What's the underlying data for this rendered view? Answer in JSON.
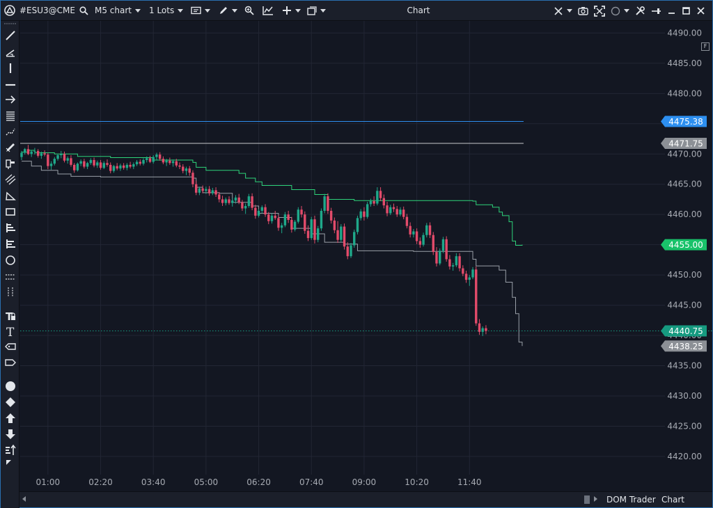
{
  "toolbar": {
    "symbol": "#ESU3@CME",
    "timeframe": "M5 chart",
    "lots": "1 Lots",
    "window_title": "Chart"
  },
  "bottom": {
    "tab_dom": "DOM Trader",
    "tab_chart": "Chart Trader"
  },
  "f_label": "F",
  "colors": {
    "background": "#131722",
    "grid": "#222634",
    "bull": "#1fa88a",
    "bear": "#e24b6a",
    "trail_green": "#2ed47a",
    "trail_gray": "#9aa0a8",
    "blue_line": "#2d8ff0"
  },
  "chart_data": {
    "type": "candlestick",
    "y_range": [
      4417,
      4492
    ],
    "y_ticks": [
      "4490.00",
      "4485.00",
      "4480.00",
      "4475.00",
      "4470.00",
      "4465.00",
      "4460.00",
      "4455.00",
      "4450.00",
      "4445.00",
      "4440.00",
      "4435.00",
      "4430.00",
      "4425.00",
      "4420.00"
    ],
    "x_ticks": [
      "01:00",
      "02:20",
      "03:40",
      "05:00",
      "06:20",
      "07:40",
      "09:00",
      "10:20",
      "11:40"
    ],
    "x_tick_bar_index": [
      8,
      24,
      40,
      56,
      72,
      88,
      104,
      120,
      136
    ],
    "bar_count": 150,
    "horizontal_lines": [
      {
        "price": 4475.38,
        "label": "4475.38",
        "color": "#2d8ff0",
        "label_bg": "#2d8ff0"
      },
      {
        "price": 4471.75,
        "label": "4471.75",
        "color": "#c7c9cc",
        "label_bg": "#8c9096"
      }
    ],
    "price_labels": [
      {
        "price": 4455.0,
        "label": "4455.00",
        "bg": "#19c26a"
      },
      {
        "price": 4440.75,
        "label": "4440.75",
        "bg": "#169a80"
      },
      {
        "price": 4438.25,
        "label": "4438.25",
        "bg": "#8c9096"
      }
    ],
    "last_price": 4440.75,
    "trail_upper": [
      [
        0,
        4470.3
      ],
      [
        2,
        4470.6
      ],
      [
        4,
        4470.2
      ],
      [
        10,
        4470.0
      ],
      [
        17,
        4469.6
      ],
      [
        27,
        4469.4
      ],
      [
        40,
        4469.0
      ],
      [
        52,
        4468.6
      ],
      [
        53,
        4467.8
      ],
      [
        56,
        4467.3
      ],
      [
        66,
        4466.8
      ],
      [
        68,
        4466.0
      ],
      [
        71,
        4465.4
      ],
      [
        73,
        4464.8
      ],
      [
        82,
        4464.1
      ],
      [
        89,
        4463.3
      ],
      [
        93,
        4462.5
      ],
      [
        101,
        4462.3
      ],
      [
        137,
        4462.2
      ],
      [
        138,
        4461.6
      ],
      [
        143,
        4461.2
      ],
      [
        145,
        4460.4
      ],
      [
        146,
        4459.8
      ],
      [
        148,
        4458.8
      ],
      [
        149,
        4455.6
      ],
      [
        150,
        4454.9
      ],
      [
        152,
        4455.0
      ]
    ],
    "trail_lower": [
      [
        0,
        4468.8
      ],
      [
        3,
        4468.0
      ],
      [
        6,
        4467.3
      ],
      [
        11,
        4466.7
      ],
      [
        15,
        4466.3
      ],
      [
        24,
        4466.2
      ],
      [
        52,
        4466.0
      ],
      [
        53,
        4464.5
      ],
      [
        55,
        4463.6
      ],
      [
        60,
        4463.5
      ],
      [
        64,
        4462.0
      ],
      [
        70,
        4461.4
      ],
      [
        72,
        4460.2
      ],
      [
        78,
        4459.5
      ],
      [
        82,
        4457.7
      ],
      [
        88,
        4456.8
      ],
      [
        92,
        4455.4
      ],
      [
        98,
        4455.1
      ],
      [
        102,
        4454.0
      ],
      [
        119,
        4453.9
      ],
      [
        137,
        4452.6
      ],
      [
        138,
        4451.5
      ],
      [
        145,
        4450.8
      ],
      [
        147,
        4448.8
      ],
      [
        149,
        4446.3
      ],
      [
        150,
        4443.6
      ],
      [
        151,
        4438.9
      ],
      [
        152,
        4438.25
      ]
    ],
    "candles": [
      [
        4469.5,
        4470.5,
        4469.0,
        4470.2
      ],
      [
        4470.2,
        4471.0,
        4469.9,
        4470.8
      ],
      [
        4470.8,
        4471.5,
        4469.8,
        4470.0
      ],
      [
        4470.0,
        4470.6,
        4469.5,
        4470.4
      ],
      [
        4470.4,
        4471.0,
        4469.9,
        4470.5
      ],
      [
        4470.5,
        4470.8,
        4469.4,
        4469.7
      ],
      [
        4469.7,
        4470.4,
        4469.2,
        4470.1
      ],
      [
        4470.1,
        4470.6,
        4469.6,
        4469.9
      ],
      [
        4469.9,
        4470.2,
        4467.5,
        4468.0
      ],
      [
        4468.0,
        4468.8,
        4467.4,
        4468.4
      ],
      [
        4468.4,
        4469.5,
        4468.1,
        4469.2
      ],
      [
        4469.2,
        4470.0,
        4468.9,
        4469.8
      ],
      [
        4469.8,
        4470.5,
        4469.3,
        4470.0
      ],
      [
        4470.0,
        4470.4,
        4468.6,
        4468.9
      ],
      [
        4468.9,
        4469.6,
        4468.4,
        4469.3
      ],
      [
        4469.3,
        4469.8,
        4467.9,
        4468.2
      ],
      [
        4468.2,
        4468.5,
        4466.9,
        4467.3
      ],
      [
        4467.3,
        4468.6,
        4467.1,
        4468.4
      ],
      [
        4468.4,
        4469.1,
        4468.0,
        4468.8
      ],
      [
        4468.8,
        4469.2,
        4467.6,
        4467.9
      ],
      [
        4467.9,
        4468.7,
        4467.5,
        4468.5
      ],
      [
        4468.5,
        4469.3,
        4468.2,
        4469.0
      ],
      [
        4469.0,
        4469.4,
        4467.8,
        4468.1
      ],
      [
        4468.1,
        4468.9,
        4467.7,
        4468.6
      ],
      [
        4468.6,
        4469.0,
        4467.4,
        4467.7
      ],
      [
        4467.7,
        4468.8,
        4467.5,
        4468.5
      ],
      [
        4468.5,
        4469.1,
        4467.9,
        4468.2
      ],
      [
        4468.2,
        4468.6,
        4466.8,
        4467.2
      ],
      [
        4467.2,
        4468.2,
        4466.9,
        4468.0
      ],
      [
        4468.0,
        4468.5,
        4467.3,
        4467.6
      ],
      [
        4467.6,
        4468.4,
        4467.2,
        4468.1
      ],
      [
        4468.1,
        4468.5,
        4467.4,
        4467.7
      ],
      [
        4467.7,
        4468.5,
        4467.3,
        4468.2
      ],
      [
        4468.2,
        4468.7,
        4467.6,
        4467.9
      ],
      [
        4467.9,
        4468.6,
        4467.5,
        4468.3
      ],
      [
        4468.3,
        4469.0,
        4468.0,
        4468.7
      ],
      [
        4468.7,
        4469.1,
        4468.1,
        4468.4
      ],
      [
        4468.4,
        4469.3,
        4468.1,
        4469.0
      ],
      [
        4469.0,
        4469.6,
        4468.6,
        4469.3
      ],
      [
        4469.3,
        4469.7,
        4468.5,
        4468.7
      ],
      [
        4468.7,
        4469.8,
        4468.4,
        4469.5
      ],
      [
        4469.5,
        4470.2,
        4469.0,
        4469.9
      ],
      [
        4469.9,
        4470.3,
        4468.9,
        4469.2
      ],
      [
        4469.2,
        4469.6,
        4468.3,
        4468.6
      ],
      [
        4468.6,
        4469.2,
        4468.0,
        4468.9
      ],
      [
        4468.9,
        4469.4,
        4468.2,
        4468.5
      ],
      [
        4468.5,
        4469.1,
        4467.9,
        4468.8
      ],
      [
        4468.8,
        4469.2,
        4467.8,
        4468.1
      ],
      [
        4468.1,
        4468.6,
        4467.5,
        4467.9
      ],
      [
        4467.9,
        4468.3,
        4466.8,
        4467.2
      ],
      [
        4467.2,
        4467.9,
        4466.5,
        4467.6
      ],
      [
        4467.6,
        4468.0,
        4466.4,
        4466.9
      ],
      [
        4466.9,
        4467.3,
        4464.5,
        4465.0
      ],
      [
        4465.0,
        4465.6,
        4463.2,
        4463.6
      ],
      [
        4463.6,
        4464.6,
        4463.2,
        4464.3
      ],
      [
        4464.3,
        4464.8,
        4463.5,
        4463.9
      ],
      [
        4463.9,
        4464.6,
        4463.4,
        4464.2
      ],
      [
        4464.2,
        4464.7,
        4463.1,
        4463.5
      ],
      [
        4463.5,
        4464.4,
        4463.2,
        4464.0
      ],
      [
        4464.0,
        4464.5,
        4462.9,
        4463.3
      ],
      [
        4463.3,
        4463.7,
        4462.0,
        4462.5
      ],
      [
        4462.5,
        4463.1,
        4461.4,
        4461.9
      ],
      [
        4461.9,
        4462.8,
        4461.5,
        4462.5
      ],
      [
        4462.5,
        4463.0,
        4461.6,
        4461.9
      ],
      [
        4461.9,
        4462.7,
        4461.3,
        4462.3
      ],
      [
        4462.3,
        4463.2,
        4461.8,
        4462.8
      ],
      [
        4462.8,
        4463.4,
        4461.7,
        4462.0
      ],
      [
        4462.0,
        4462.4,
        4460.6,
        4461.0
      ],
      [
        4461.0,
        4461.8,
        4460.1,
        4461.4
      ],
      [
        4461.4,
        4463.4,
        4461.1,
        4463.0
      ],
      [
        4463.0,
        4463.5,
        4460.7,
        4461.1
      ],
      [
        4461.1,
        4461.6,
        4459.3,
        4459.8
      ],
      [
        4459.8,
        4460.9,
        4459.5,
        4460.6
      ],
      [
        4460.6,
        4461.5,
        4460.2,
        4461.2
      ],
      [
        4461.2,
        4461.7,
        4459.6,
        4460.0
      ],
      [
        4460.0,
        4460.4,
        4458.4,
        4458.9
      ],
      [
        4458.9,
        4460.2,
        4458.5,
        4459.8
      ],
      [
        4459.8,
        4460.6,
        4459.1,
        4459.4
      ],
      [
        4459.4,
        4459.9,
        4457.3,
        4457.8
      ],
      [
        4457.8,
        4458.6,
        4456.9,
        4458.2
      ],
      [
        4458.2,
        4460.4,
        4457.9,
        4460.0
      ],
      [
        4460.0,
        4460.6,
        4458.6,
        4459.1
      ],
      [
        4459.1,
        4459.6,
        4457.0,
        4457.5
      ],
      [
        4457.5,
        4459.1,
        4457.2,
        4458.8
      ],
      [
        4458.8,
        4461.2,
        4458.5,
        4460.8
      ],
      [
        4460.8,
        4461.4,
        4459.5,
        4460.0
      ],
      [
        4460.0,
        4460.5,
        4456.8,
        4457.3
      ],
      [
        4457.3,
        4458.2,
        4455.6,
        4456.1
      ],
      [
        4456.1,
        4459.6,
        4455.8,
        4459.2
      ],
      [
        4459.2,
        4459.8,
        4455.2,
        4455.8
      ],
      [
        4455.8,
        4458.1,
        4455.4,
        4457.7
      ],
      [
        4457.7,
        4461.0,
        4457.3,
        4460.6
      ],
      [
        4460.6,
        4463.4,
        4460.2,
        4463.0
      ],
      [
        4463.0,
        4463.5,
        4460.1,
        4460.6
      ],
      [
        4460.6,
        4461.1,
        4458.5,
        4459.0
      ],
      [
        4459.0,
        4459.5,
        4456.9,
        4457.4
      ],
      [
        4457.4,
        4458.9,
        4455.3,
        4455.8
      ],
      [
        4455.8,
        4458.4,
        4455.5,
        4458.0
      ],
      [
        4458.0,
        4458.5,
        4454.2,
        4454.7
      ],
      [
        4454.7,
        4455.4,
        4452.6,
        4453.1
      ],
      [
        4453.1,
        4455.3,
        4452.8,
        4454.9
      ],
      [
        4454.9,
        4457.5,
        4454.5,
        4457.1
      ],
      [
        4457.1,
        4459.8,
        4456.7,
        4459.4
      ],
      [
        4459.4,
        4460.9,
        4459.0,
        4460.5
      ],
      [
        4460.5,
        4461.2,
        4459.0,
        4459.6
      ],
      [
        4459.6,
        4462.1,
        4459.3,
        4461.7
      ],
      [
        4461.7,
        4462.6,
        4461.3,
        4462.2
      ],
      [
        4462.2,
        4463.0,
        4461.4,
        4461.8
      ],
      [
        4461.8,
        4464.5,
        4461.5,
        4463.9
      ],
      [
        4463.9,
        4464.5,
        4462.2,
        4462.7
      ],
      [
        4462.7,
        4463.3,
        4461.0,
        4461.5
      ],
      [
        4461.5,
        4462.1,
        4459.7,
        4460.2
      ],
      [
        4460.2,
        4461.6,
        4459.9,
        4461.2
      ],
      [
        4461.2,
        4461.8,
        4460.4,
        4460.9
      ],
      [
        4460.9,
        4461.4,
        4459.6,
        4460.0
      ],
      [
        4460.0,
        4461.2,
        4459.7,
        4460.8
      ],
      [
        4460.8,
        4461.3,
        4459.2,
        4459.6
      ],
      [
        4459.6,
        4460.1,
        4457.7,
        4458.1
      ],
      [
        4458.1,
        4458.7,
        4456.2,
        4456.7
      ],
      [
        4456.7,
        4457.6,
        4456.2,
        4457.2
      ],
      [
        4457.2,
        4457.7,
        4455.1,
        4455.6
      ],
      [
        4455.6,
        4456.2,
        4454.5,
        4455.0
      ],
      [
        4455.0,
        4457.0,
        4454.7,
        4456.6
      ],
      [
        4456.6,
        4458.6,
        4456.2,
        4458.2
      ],
      [
        4458.2,
        4458.7,
        4456.1,
        4456.6
      ],
      [
        4456.6,
        4457.1,
        4453.3,
        4453.8
      ],
      [
        4453.8,
        4454.6,
        4451.4,
        4451.9
      ],
      [
        4451.9,
        4454.4,
        4451.6,
        4454.0
      ],
      [
        4454.0,
        4456.3,
        4453.6,
        4455.9
      ],
      [
        4455.9,
        4456.4,
        4452.2,
        4452.6
      ],
      [
        4452.6,
        4453.3,
        4450.9,
        4451.4
      ],
      [
        4451.4,
        4452.0,
        4450.7,
        4451.6
      ],
      [
        4451.6,
        4453.6,
        4451.3,
        4453.1
      ],
      [
        4453.1,
        4453.6,
        4450.6,
        4451.1
      ],
      [
        4451.1,
        4451.6,
        4449.8,
        4450.2
      ],
      [
        4450.2,
        4450.7,
        4448.7,
        4449.2
      ],
      [
        4449.2,
        4450.0,
        4448.2,
        4449.6
      ],
      [
        4449.6,
        4451.3,
        4449.3,
        4450.9
      ],
      [
        4450.9,
        4451.4,
        4441.6,
        4442.0
      ],
      [
        4442.0,
        4442.7,
        4440.1,
        4440.6
      ],
      [
        4440.6,
        4441.5,
        4439.9,
        4441.2
      ],
      [
        4441.2,
        4441.7,
        4440.2,
        4440.75
      ]
    ]
  }
}
